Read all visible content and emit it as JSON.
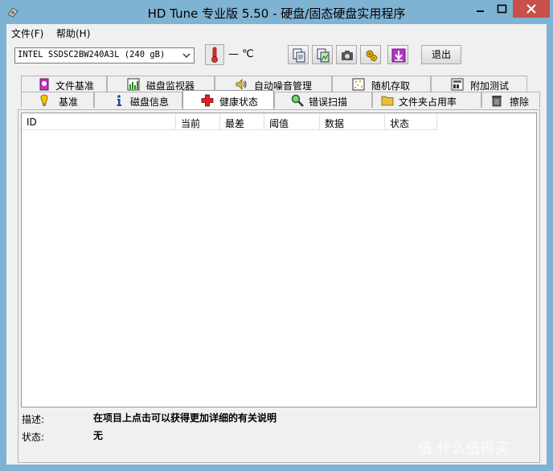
{
  "window": {
    "title": "HD Tune 专业版 5.50 - 硬盘/固态硬盘实用程序"
  },
  "menu": {
    "file": "文件(F)",
    "help": "帮助(H)"
  },
  "toolbar": {
    "drive": "INTEL SSDSC2BW240A3L (240 gB)",
    "temperature": "— ℃",
    "exit_label": "退出",
    "buttons": [
      "copy-text-icon",
      "copy-screenshot-icon",
      "camera-icon",
      "options-icon",
      "save-icon"
    ]
  },
  "tabs": {
    "top": [
      "文件基准",
      "磁盘监视器",
      "自动噪音管理",
      "随机存取",
      "附加测试"
    ],
    "bottom": [
      "基准",
      "磁盘信息",
      "健康状态",
      "错误扫描",
      "文件夹占用率",
      "擦除"
    ],
    "active": "健康状态"
  },
  "table": {
    "columns": [
      "ID",
      "当前",
      "最差",
      "阈值",
      "数据",
      "状态"
    ],
    "rows": []
  },
  "details": {
    "desc_label": "描述:",
    "desc_value": "在项目上点击可以获得更加详细的有关说明",
    "status_label": "状态:",
    "status_value": "无"
  },
  "watermark": "值 什么值得买",
  "colors": {
    "titlebar": "#7fb3d3",
    "close": "#c7504b",
    "panel": "#f0f0f0"
  }
}
